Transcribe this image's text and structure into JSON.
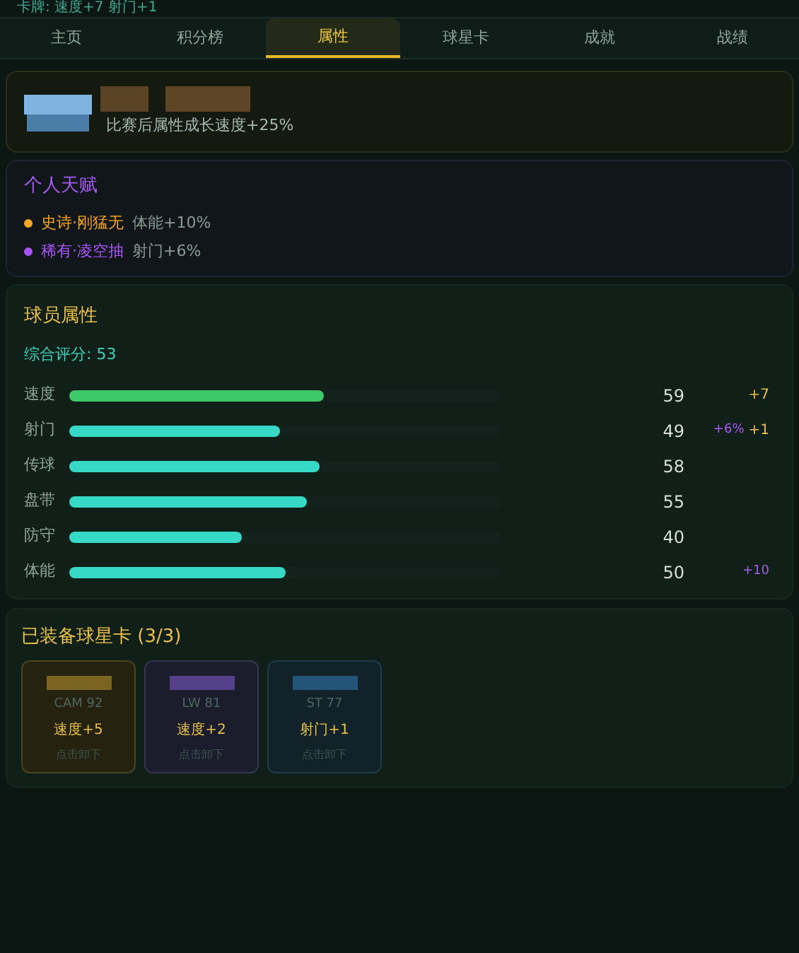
{
  "top_line": "卡牌: 速度+7 射门+1",
  "tabs": [
    {
      "label": "主页",
      "selected": false
    },
    {
      "label": "积分榜",
      "selected": false
    },
    {
      "label": "属性",
      "selected": true
    },
    {
      "label": "球星卡",
      "selected": false
    },
    {
      "label": "成就",
      "selected": false
    },
    {
      "label": "战绩",
      "selected": false
    }
  ],
  "bonus_card": {
    "text": "比赛后属性成长速度+25%"
  },
  "talents": {
    "title": "个人天赋",
    "items": [
      {
        "name": "史诗·刚猛无",
        "effect": "体能+10%",
        "color": "#f5a623"
      },
      {
        "name": "稀有·凌空抽",
        "effect": "射门+6%",
        "color": "#a855f7"
      }
    ]
  },
  "attributes": {
    "title": "球员属性",
    "overall": "综合评分: 53",
    "rows": [
      {
        "label": "速度",
        "level": 0.59,
        "value": "59",
        "color": "#3ec86a",
        "bonuses": [
          {
            "text": "+7",
            "kind": "flat"
          }
        ]
      },
      {
        "label": "射门",
        "level": 0.49,
        "value": "49",
        "color": "#36d8c6",
        "bonuses": [
          {
            "text": "+6%",
            "kind": "percent"
          },
          {
            "text": "+1",
            "kind": "flat"
          }
        ]
      },
      {
        "label": "传球",
        "level": 0.58,
        "value": "58",
        "color": "#36d8c6",
        "bonuses": []
      },
      {
        "label": "盘带",
        "level": 0.55,
        "value": "55",
        "color": "#36d8c6",
        "bonuses": []
      },
      {
        "label": "防守",
        "level": 0.4,
        "value": "40",
        "color": "#36d8c6",
        "bonuses": []
      },
      {
        "label": "体能",
        "level": 0.5,
        "value": "50",
        "color": "#36d8c6",
        "bonuses": [
          {
            "text": "+10",
            "kind": "percent"
          }
        ]
      }
    ]
  },
  "equipped": {
    "title": "已装备球星卡 (3/3)",
    "cards": [
      {
        "position": "CAM 92",
        "bonus": "速度+5",
        "action": "点击卸下",
        "kind": "gold"
      },
      {
        "position": "LW 81",
        "bonus": "速度+2",
        "action": "点击卸下",
        "kind": "purple"
      },
      {
        "position": "ST 77",
        "bonus": "射门+1",
        "action": "点击卸下",
        "kind": "blue"
      }
    ]
  }
}
